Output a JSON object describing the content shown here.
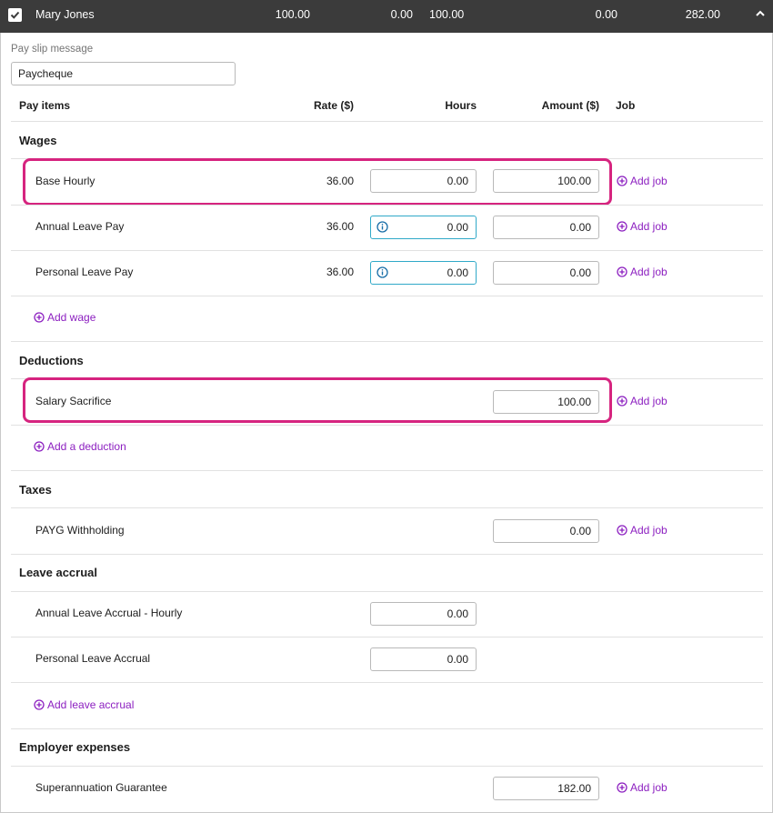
{
  "employee_row": {
    "name": "Mary Jones",
    "col1": "100.00",
    "col2": "0.00",
    "col3": "100.00",
    "col4": "0.00",
    "col5": "282.00"
  },
  "pay_slip": {
    "label": "Pay slip message",
    "value": "Paycheque"
  },
  "columns": {
    "pay_items": "Pay items",
    "rate": "Rate ($)",
    "hours": "Hours",
    "amount": "Amount ($)",
    "job": "Job"
  },
  "wages": {
    "title": "Wages",
    "items": [
      {
        "name": "Base Hourly",
        "rate": "36.00",
        "hours": "0.00",
        "amount": "100.00",
        "job": "Add job"
      },
      {
        "name": "Annual Leave Pay",
        "rate": "36.00",
        "hours": "0.00",
        "amount": "0.00",
        "job": "Add job"
      },
      {
        "name": "Personal Leave Pay",
        "rate": "36.00",
        "hours": "0.00",
        "amount": "0.00",
        "job": "Add job"
      }
    ],
    "add_label": "Add wage"
  },
  "deductions": {
    "title": "Deductions",
    "items": [
      {
        "name": "Salary Sacrifice",
        "amount": "100.00",
        "job": "Add job"
      }
    ],
    "add_label": "Add a deduction"
  },
  "taxes": {
    "title": "Taxes",
    "items": [
      {
        "name": "PAYG Withholding",
        "amount": "0.00",
        "job": "Add job"
      }
    ]
  },
  "leave_accrual": {
    "title": "Leave accrual",
    "items": [
      {
        "name": "Annual Leave Accrual - Hourly",
        "hours": "0.00"
      },
      {
        "name": "Personal Leave Accrual",
        "hours": "0.00"
      }
    ],
    "add_label": "Add leave accrual"
  },
  "employer_expenses": {
    "title": "Employer expenses",
    "items": [
      {
        "name": "Superannuation Guarantee",
        "amount": "182.00",
        "job": "Add job"
      }
    ]
  },
  "colors": {
    "header_bg": "#3b3b3b",
    "link": "#8c1fc0",
    "highlight": "#d6247f",
    "info_border": "#30a9c8"
  },
  "icons": {
    "checkbox": "checkbox-checked-icon",
    "collapse": "chevron-up-icon",
    "add": "plus-circle-icon",
    "info": "info-icon"
  }
}
